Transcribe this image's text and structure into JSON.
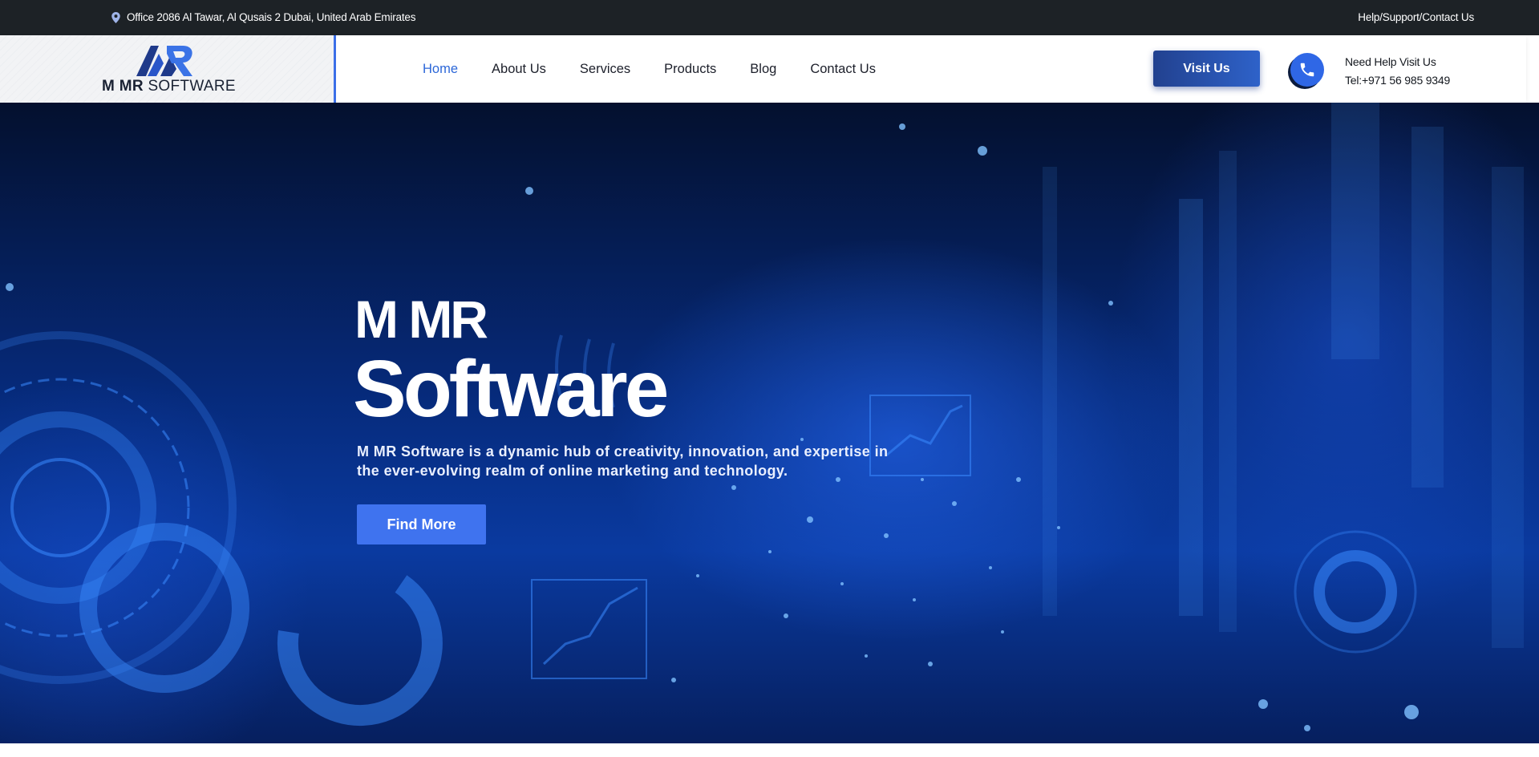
{
  "topbar": {
    "address": "Office 2086 Al Tawar, Al Qusais 2 Dubai, United Arab Emirates",
    "help_link": "Help/Support/Contact Us"
  },
  "logo": {
    "bold": "M MR",
    "light": "SOFTWARE"
  },
  "nav": [
    {
      "label": "Home",
      "active": true
    },
    {
      "label": "About Us"
    },
    {
      "label": "Services"
    },
    {
      "label": "Products"
    },
    {
      "label": "Blog"
    },
    {
      "label": "Contact Us"
    }
  ],
  "header": {
    "visit_button": "Visit Us",
    "help_title": "Need Help Visit Us",
    "help_phone": "Tel:+971 56 985 9349"
  },
  "hero": {
    "title_small": "M MR",
    "title_big": "Software",
    "description": "M MR Software is a dynamic hub of creativity, innovation, and expertise in the ever-evolving realm of online marketing and technology.",
    "cta": "Find More"
  },
  "colors": {
    "accent": "#3f73ef",
    "nav_active": "#2c67d8",
    "topbar_bg": "#1d2226",
    "hero_bg": "#062a7a"
  },
  "icons": [
    "location-pin-icon",
    "phone-icon"
  ]
}
